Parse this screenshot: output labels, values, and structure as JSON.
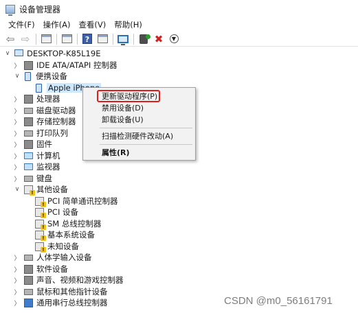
{
  "window": {
    "title": "设备管理器"
  },
  "menubar": [
    {
      "label": "文件(F)"
    },
    {
      "label": "操作(A)"
    },
    {
      "label": "查看(V)"
    },
    {
      "label": "帮助(H)"
    }
  ],
  "tree": {
    "root": "DESKTOP-K85L19E",
    "items": [
      {
        "label": "IDE ATA/ATAPI 控制器",
        "expanded": false,
        "icon": "ide-controller-icon"
      },
      {
        "label": "便携设备",
        "expanded": true,
        "icon": "portable-device-icon"
      },
      {
        "label": "Apple iPhone",
        "child": true,
        "selected": true,
        "icon": "iphone-icon"
      },
      {
        "label": "处理器",
        "expanded": false,
        "icon": "processor-icon"
      },
      {
        "label": "磁盘驱动器",
        "expanded": false,
        "icon": "disk-drive-icon"
      },
      {
        "label": "存储控制器",
        "expanded": false,
        "icon": "storage-controller-icon"
      },
      {
        "label": "打印队列",
        "expanded": false,
        "icon": "print-queue-icon"
      },
      {
        "label": "固件",
        "expanded": false,
        "icon": "firmware-icon"
      },
      {
        "label": "计算机",
        "expanded": false,
        "icon": "computer-icon"
      },
      {
        "label": "监视器",
        "expanded": false,
        "icon": "monitor-icon"
      },
      {
        "label": "键盘",
        "expanded": false,
        "icon": "keyboard-icon"
      },
      {
        "label": "其他设备",
        "expanded": true,
        "icon": "other-devices-icon"
      },
      {
        "label": "PCI 简单通讯控制器",
        "child": true,
        "icon": "unknown-device-warning-icon"
      },
      {
        "label": "PCI 设备",
        "child": true,
        "icon": "unknown-device-warning-icon"
      },
      {
        "label": "SM 总线控制器",
        "child": true,
        "icon": "unknown-device-warning-icon"
      },
      {
        "label": "基本系统设备",
        "child": true,
        "icon": "unknown-device-warning-icon"
      },
      {
        "label": "未知设备",
        "child": true,
        "icon": "unknown-device-warning-icon"
      },
      {
        "label": "人体学输入设备",
        "expanded": false,
        "icon": "hid-icon"
      },
      {
        "label": "软件设备",
        "expanded": false,
        "icon": "software-device-icon"
      },
      {
        "label": "声音、视频和游戏控制器",
        "expanded": false,
        "icon": "sound-icon"
      },
      {
        "label": "鼠标和其他指针设备",
        "expanded": false,
        "icon": "mouse-icon"
      },
      {
        "label": "通用串行总线控制器",
        "expanded": false,
        "icon": "usb-icon"
      }
    ]
  },
  "context_menu": {
    "items": [
      {
        "label": "更新驱动程序(P)",
        "highlighted": true
      },
      {
        "label": "禁用设备(D)"
      },
      {
        "label": "卸载设备(U)"
      },
      {
        "label": "扫描检测硬件改动(A)"
      },
      {
        "label": "属性(R)",
        "bold": true
      }
    ]
  },
  "watermark": "CSDN @m0_56161791",
  "colors": {
    "highlight_box": "#e11c1c",
    "selection": "#cde8ff"
  }
}
